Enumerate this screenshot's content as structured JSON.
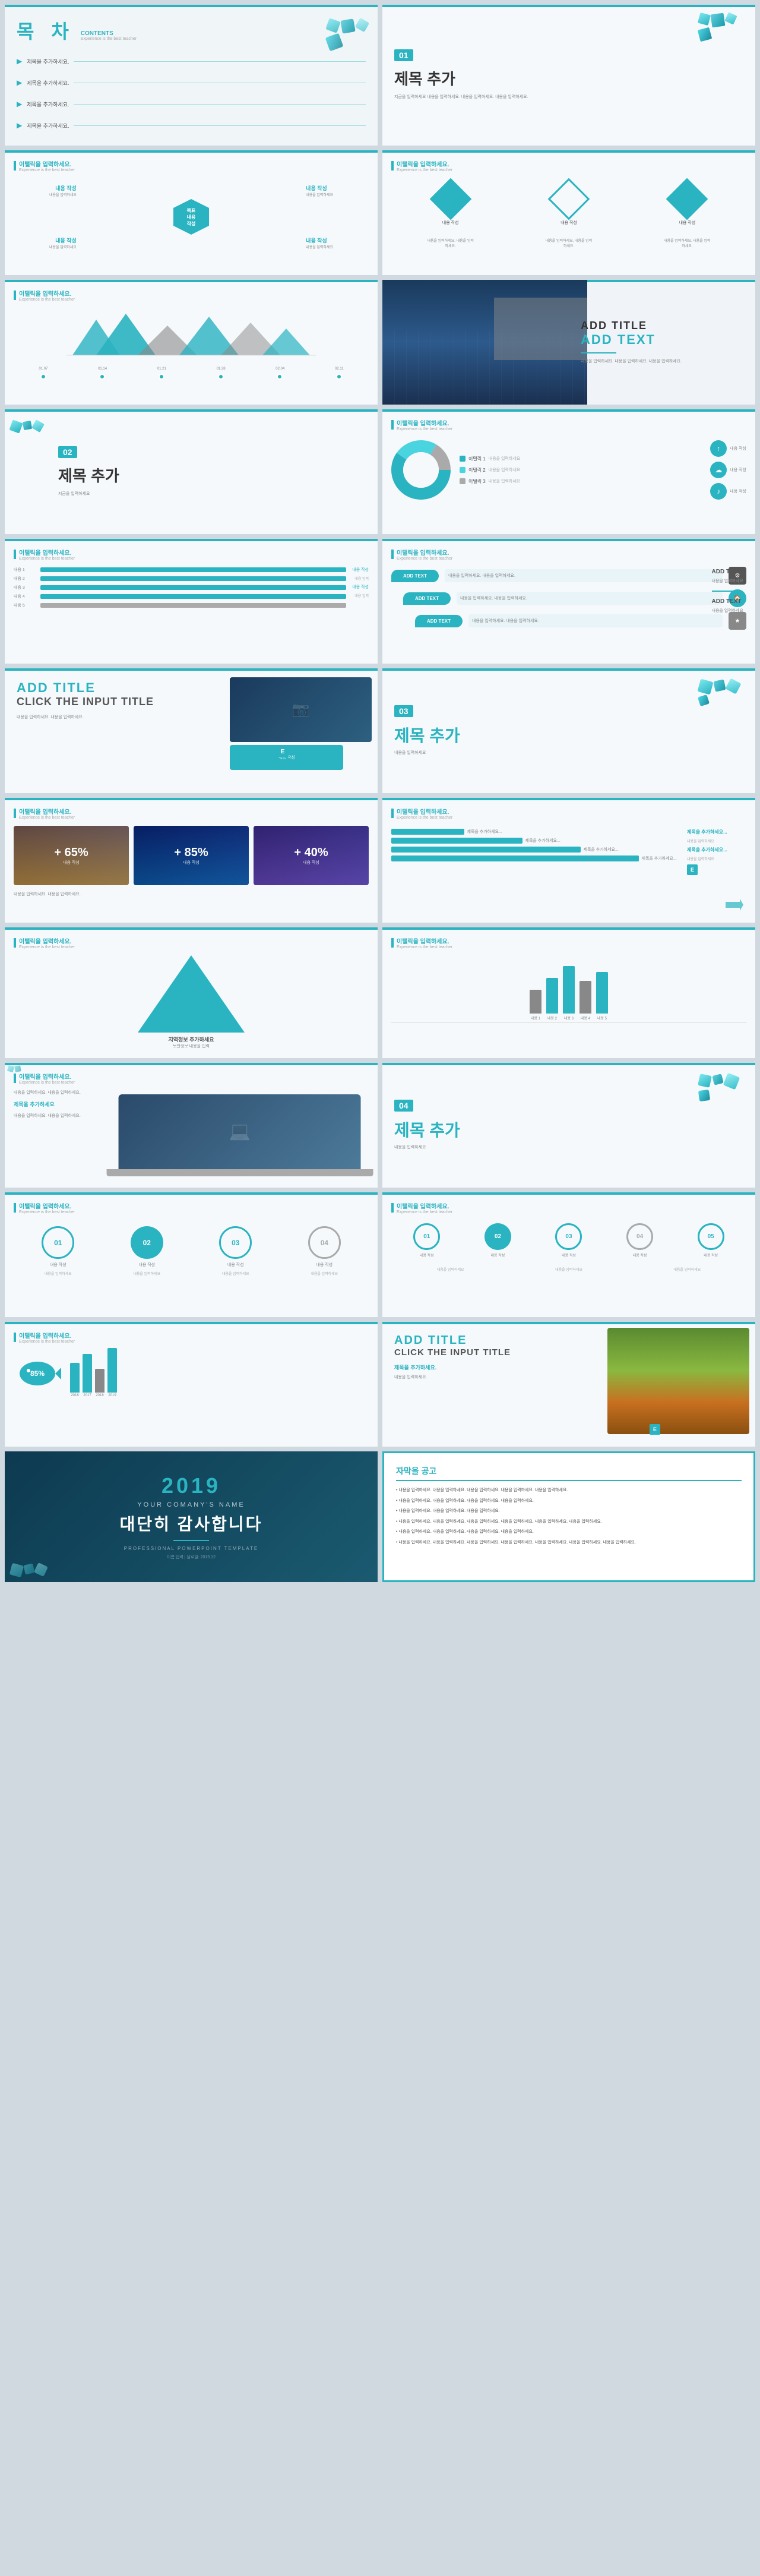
{
  "slides": [
    {
      "id": "slide-1",
      "type": "toc",
      "title_kr": "목 차",
      "title_en": "CONTENTS",
      "subtitle": "Experience is the best teacher",
      "toc_items": [
        "제목을 추가하세요.",
        "제목을 추가하세요.",
        "제목을 추가하세요.",
        "제목을 추가하세요."
      ]
    },
    {
      "id": "slide-2",
      "type": "title_num",
      "num": "01",
      "title_kr": "제목 추가",
      "desc": "지금을 입력하세요\n내용을 입력하세요. 내용을 입력하세요. 내용을 입력하세요."
    },
    {
      "id": "slide-3",
      "type": "content_grid",
      "header": "이탤릭을 입력하세요.",
      "sub": "Experience is the best teacher",
      "items": [
        "내용 작성",
        "내용 작성",
        "목표 내용 작성",
        "내용 작성",
        "내용 작성"
      ]
    },
    {
      "id": "slide-4",
      "type": "content_right",
      "header": "이탤릭을 입력하세요.",
      "sub": "Experience is the best teacher"
    },
    {
      "id": "slide-5",
      "type": "mountain",
      "header": "이탤릭을 입력하세요.",
      "sub": "Experience is the best teacher",
      "labels": [
        "01.07",
        "01.14",
        "01.21",
        "01.28",
        "02.04",
        "02.11"
      ]
    },
    {
      "id": "slide-6",
      "type": "add_title",
      "title": "ADD TITLE",
      "text": "ADD TEXT",
      "body": "내용을 입력하세요. 내용을 입력하세요. 내용을 입력하세요."
    },
    {
      "id": "slide-7",
      "type": "title_num_2",
      "num": "02",
      "title_kr": "제목 추가",
      "desc": "지금을 입력하세요"
    },
    {
      "id": "slide-8",
      "type": "pie_chart",
      "header": "이탤릭을 입력하세요.",
      "sub": "Experience is the best teacher",
      "items": [
        "이탤릭 1",
        "이탤릭 2",
        "이탤릭 3"
      ]
    },
    {
      "id": "slide-9",
      "type": "bar_compare",
      "header": "이탤릭을 입력하세요.",
      "sub": "Experience is the best teacher",
      "labels": [
        "내용 작성",
        "내용 작성",
        "내용 작성",
        "내용 작성"
      ]
    },
    {
      "id": "slide-10",
      "type": "wave_steps",
      "header": "이탤릭을 입력하세요.",
      "sub": "Experience is the best teacher",
      "steps": [
        "ADD TEXT",
        "ADD TEXT",
        "ADD TEXT"
      ],
      "desc": "내용을 입력하세요. 내용을 입력하세요."
    },
    {
      "id": "slide-11",
      "type": "add_title_click",
      "title": "ADD TITLE",
      "subtitle": "CLICK THE INPUT TITLE",
      "body": "내용을 입력하세요. 내용을 입력하세요."
    },
    {
      "id": "slide-12",
      "type": "title_num_3",
      "num": "03",
      "title_kr": "제목 추가",
      "desc": "내용을 입력하세요"
    },
    {
      "id": "slide-13",
      "type": "percent_boxes",
      "header": "이탤릭을 입력하세요.",
      "sub": "Experience is the best teacher",
      "items": [
        {
          "value": "+ 65%",
          "label": "내용 작성"
        },
        {
          "value": "+ 85%",
          "label": "내용 작성"
        },
        {
          "value": "+ 40%",
          "label": "내용 작성"
        }
      ]
    },
    {
      "id": "slide-14",
      "type": "staircase",
      "header": "이탤릭을 입력하세요.",
      "sub": "Experience is the best teacher",
      "items": [
        "제목을 추가하세요...",
        "제목을 추가하세요...",
        "제목을 추가하세요...",
        "제목을 추가하세요..."
      ]
    },
    {
      "id": "slide-15",
      "type": "triangle",
      "header": "이탤릭을 입력하세요.",
      "sub": "Experience is the best teacher",
      "title": "지역정보 추가하세요",
      "subtitle": "보안정보 내용을 입력"
    },
    {
      "id": "slide-16",
      "type": "v_bars",
      "header": "이탤릭을 입력하세요.",
      "sub": "Experience is the best teacher",
      "labels": [
        "내용 1",
        "내용 2",
        "내용 3",
        "내용 4",
        "내용 5"
      ]
    },
    {
      "id": "slide-17",
      "type": "laptop_img",
      "header": "이탤릭을 입력하세요.",
      "sub": "Experience is the best teacher"
    },
    {
      "id": "slide-18",
      "type": "title_num_4",
      "num": "04",
      "title_kr": "제목 추가",
      "desc": "내용을 입력하세요"
    },
    {
      "id": "slide-19",
      "type": "circles_row",
      "header": "이탤릭을 입력하세요.",
      "sub": "Experience is the best teacher",
      "items": [
        "01",
        "02",
        "03",
        "04"
      ]
    },
    {
      "id": "slide-20",
      "type": "circles_v2",
      "header": "이탤릭을 입력하세요.",
      "sub": "Experience is the best teacher",
      "items": [
        "01",
        "02",
        "03",
        "04",
        "05"
      ]
    },
    {
      "id": "slide-21",
      "type": "fish_chart",
      "header": "이탤릭을 입력하세요.",
      "sub": "Experience is the best teacher",
      "percent": "85%"
    },
    {
      "id": "slide-22",
      "type": "add_title_click_2",
      "title": "ADD TITLE",
      "subtitle": "CLICK THE INPUT TITLE",
      "desc": "제목을 추가하세요.",
      "body": "내용을 입력하세요."
    },
    {
      "id": "slide-23",
      "type": "final",
      "year": "2019",
      "company": "YOUR COMANY'S NAME",
      "thanks": "대단히 감사합니다",
      "template": "PROFESSIONAL POWERPOINT TEMPLATE",
      "info": "이름 입력 | 날로일: 2019.12"
    },
    {
      "id": "slide-24",
      "type": "text_block",
      "title": "자막을 공고",
      "body": "내용을 입력하세요. 내용을 입력하세요. 내용을 입력하세요. 내용을 입력하세요."
    }
  ],
  "colors": {
    "teal": "#2ab3c0",
    "dark_teal": "#1a8a96",
    "gray": "#888888",
    "light_bg": "#f5f9fc",
    "dark_bg": "#1a3a5c"
  }
}
